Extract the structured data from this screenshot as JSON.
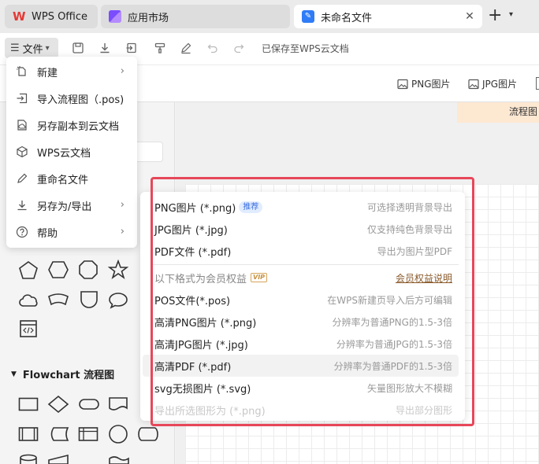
{
  "tabs": [
    {
      "label": "WPS Office"
    },
    {
      "label": "应用市场"
    },
    {
      "label": "未命名文件"
    }
  ],
  "toolbar": {
    "file_label": "文件",
    "saved_status": "已保存至WPS云文档"
  },
  "export_bar": {
    "png_label": "PNG图片",
    "jpg_label": "JPG图片"
  },
  "canvas": {
    "orange_label": "流程图"
  },
  "file_menu": {
    "items": [
      {
        "label": "新建",
        "icon": "new-file-icon",
        "has_submenu": true
      },
      {
        "label": "导入流程图（.pos)",
        "icon": "import-icon",
        "has_submenu": false
      },
      {
        "label": "另存副本到云文档",
        "icon": "cloud-copy-icon",
        "has_submenu": false
      },
      {
        "label": "WPS云文档",
        "icon": "cube-icon",
        "has_submenu": false
      },
      {
        "label": "重命名文件",
        "icon": "pencil-icon",
        "has_submenu": false
      },
      {
        "label": "另存为/导出",
        "icon": "download-icon",
        "has_submenu": true
      },
      {
        "label": "帮助",
        "icon": "help-icon",
        "has_submenu": true
      }
    ]
  },
  "export_menu": {
    "png": {
      "label": "PNG图片 (*.png)",
      "badge": "推荐",
      "desc": "可选择透明背景导出"
    },
    "jpg": {
      "label": "JPG图片 (*.jpg)",
      "desc": "仅支持纯色背景导出"
    },
    "pdf": {
      "label": "PDF文件 (*.pdf)",
      "desc": "导出为图片型PDF"
    },
    "member_header": {
      "label": "以下格式为会员权益",
      "badge": "VIP",
      "link": "会员权益说明"
    },
    "pos": {
      "label": "POS文件(*.pos)",
      "desc": "在WPS新建页导入后方可编辑"
    },
    "hd_png": {
      "label": "高清PNG图片 (*.png)",
      "desc": "分辨率为普通PNG的1.5-3倍"
    },
    "hd_jpg": {
      "label": "高清JPG图片 (*.jpg)",
      "desc": "分辨率为普通JPG的1.5-3倍"
    },
    "hd_pdf": {
      "label": "高清PDF (*.pdf)",
      "desc": "分辨率为普通PDF的1.5-3倍"
    },
    "svg": {
      "label": "svg无损图片 (*.svg)",
      "desc": "矢量图形放大不模糊"
    },
    "selection": {
      "label": "导出所选图形为 (*.png)",
      "desc": "导出部分图形"
    }
  },
  "shape_panel": {
    "flowchart_title": "Flowchart 流程图"
  },
  "colors": {
    "highlight_outline": "#e74759",
    "wps_brand": "#e53935",
    "member_link": "#8a5a2b"
  }
}
